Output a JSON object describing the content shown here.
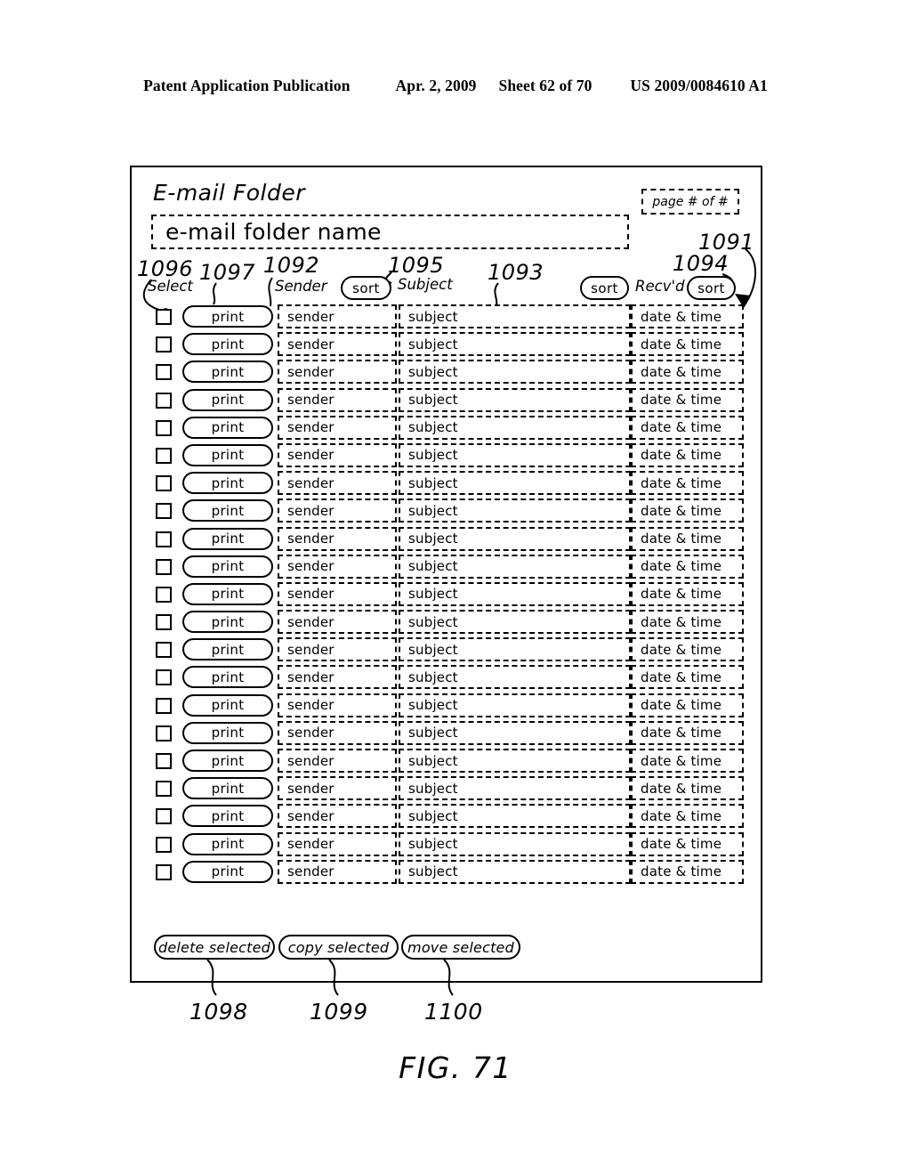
{
  "publication": {
    "left": "Patent Application Publication",
    "date": "Apr. 2, 2009",
    "sheet": "Sheet 62 of 70",
    "number": "US 2009/0084610 A1"
  },
  "figure": {
    "caption": "FIG. 71"
  },
  "screen": {
    "title": "E-mail Folder",
    "page_indicator": "page # of #",
    "folder_name_value": "e-mail folder name",
    "columns": {
      "select": "Select",
      "sender": "Sender",
      "subject": "Subject",
      "received": "Recv'd"
    },
    "sort_buttons": {
      "sender_sort": "sort",
      "subject_sort": "sort",
      "received_sort": "sort"
    },
    "row_template": {
      "print_label": "print",
      "sender": "sender",
      "subject": "subject",
      "date": "date & time"
    },
    "row_count": 21,
    "actions": {
      "delete": "delete selected",
      "copy": "copy selected",
      "move": "move selected"
    }
  },
  "reference_numerals": {
    "n1091": "1091",
    "n1092": "1092",
    "n1093": "1093",
    "n1094": "1094",
    "n1095": "1095",
    "n1096": "1096",
    "n1097": "1097",
    "n1098": "1098",
    "n1099": "1099",
    "n1100": "1100"
  },
  "colors": {
    "ink": "#000000",
    "paper": "#ffffff"
  }
}
